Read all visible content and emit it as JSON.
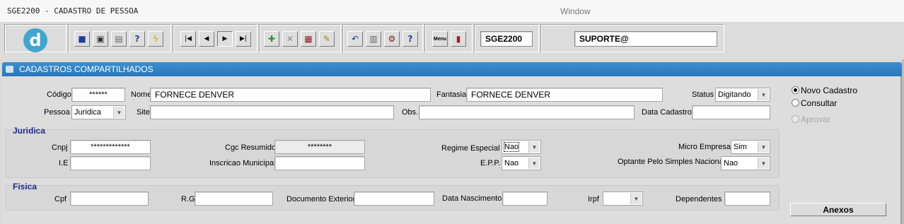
{
  "window": {
    "app_title": "SGE2200 - CADASTRO DE PESSOA",
    "window_label": "Window"
  },
  "toolbar": {
    "logo_letter": "d",
    "module_code": "SGE2200",
    "user": "SUPORTE@",
    "buttons": [
      {
        "name": "save-icon",
        "glyph": "💾"
      },
      {
        "name": "screen-icon",
        "glyph": "▢"
      },
      {
        "name": "print-icon",
        "glyph": "⎙"
      },
      {
        "name": "query-help-icon",
        "glyph": "?"
      },
      {
        "name": "execute-query-icon",
        "glyph": "⚡"
      },
      {
        "name": "first-record-icon",
        "glyph": "⏮"
      },
      {
        "name": "previous-record-icon",
        "glyph": "◀"
      },
      {
        "name": "next-record-icon",
        "glyph": "▶"
      },
      {
        "name": "last-record-icon",
        "glyph": "⏭"
      },
      {
        "name": "insert-record-icon",
        "glyph": "✚"
      },
      {
        "name": "delete-record-icon",
        "glyph": "✕"
      },
      {
        "name": "clear-form-icon",
        "glyph": "▣"
      },
      {
        "name": "edit-icon",
        "glyph": "✎"
      },
      {
        "name": "undo-icon",
        "glyph": "↶"
      },
      {
        "name": "list-values-icon",
        "glyph": "☰"
      },
      {
        "name": "tools-icon",
        "glyph": "⚙"
      },
      {
        "name": "help-icon",
        "glyph": "?"
      },
      {
        "name": "menu-icon",
        "glyph": "Menu"
      },
      {
        "name": "exit-icon",
        "glyph": "▮"
      }
    ],
    "colors": {
      "accent_blue": "#2a7fc4",
      "logo": "#3fa6cf"
    }
  },
  "panel": {
    "title": "CADASTROS COMPARTILHADOS"
  },
  "form": {
    "codigo": {
      "label": "Código",
      "value": "******"
    },
    "nome": {
      "label": "Nome",
      "value": "FORNECE DENVER"
    },
    "fantasia": {
      "label": "Fantasia",
      "value": "FORNECE DENVER"
    },
    "status": {
      "label": "Status",
      "value": "Digitando"
    },
    "pessoa": {
      "label": "Pessoa",
      "value": "Juridica"
    },
    "site": {
      "label": "Site",
      "value": ""
    },
    "obs": {
      "label": "Obs.",
      "value": ""
    },
    "data_cadastro": {
      "label": "Data Cadastro",
      "value": ""
    }
  },
  "juridica": {
    "title": "Juridica",
    "cnpj": {
      "label": "Cnpj",
      "value": "*************"
    },
    "cgc_resumido": {
      "label": "Cgc Resumido",
      "value": "********"
    },
    "regime_especial": {
      "label": "Regime Especial",
      "value": "Nao"
    },
    "micro_empresa": {
      "label": "Micro Empresa",
      "value": "Sim"
    },
    "ie": {
      "label": "I.E",
      "value": ""
    },
    "inscricao_municipal": {
      "label": "Inscricao Municipal",
      "value": ""
    },
    "epp": {
      "label": "E.P.P.",
      "value": "Nao"
    },
    "optante_simples": {
      "label": "Optante Pelo Simples Nacional",
      "value": "Nao"
    }
  },
  "fisica": {
    "title": "Fisica",
    "cpf": {
      "label": "Cpf",
      "value": ""
    },
    "rg": {
      "label": "R.G",
      "value": ""
    },
    "documento_exterior": {
      "label": "Documento Exterior",
      "value": ""
    },
    "data_nascimento": {
      "label": "Data Nascimento",
      "value": ""
    },
    "irpf": {
      "label": "Irpf",
      "value": ""
    },
    "dependentes": {
      "label": "Dependentes",
      "value": ""
    }
  },
  "mode": {
    "novo_cadastro": "Novo Cadastro",
    "consultar": "Consultar",
    "aprovar": "Aprovar",
    "selected": "novo_cadastro"
  },
  "actions": {
    "anexos": "Anexos"
  }
}
